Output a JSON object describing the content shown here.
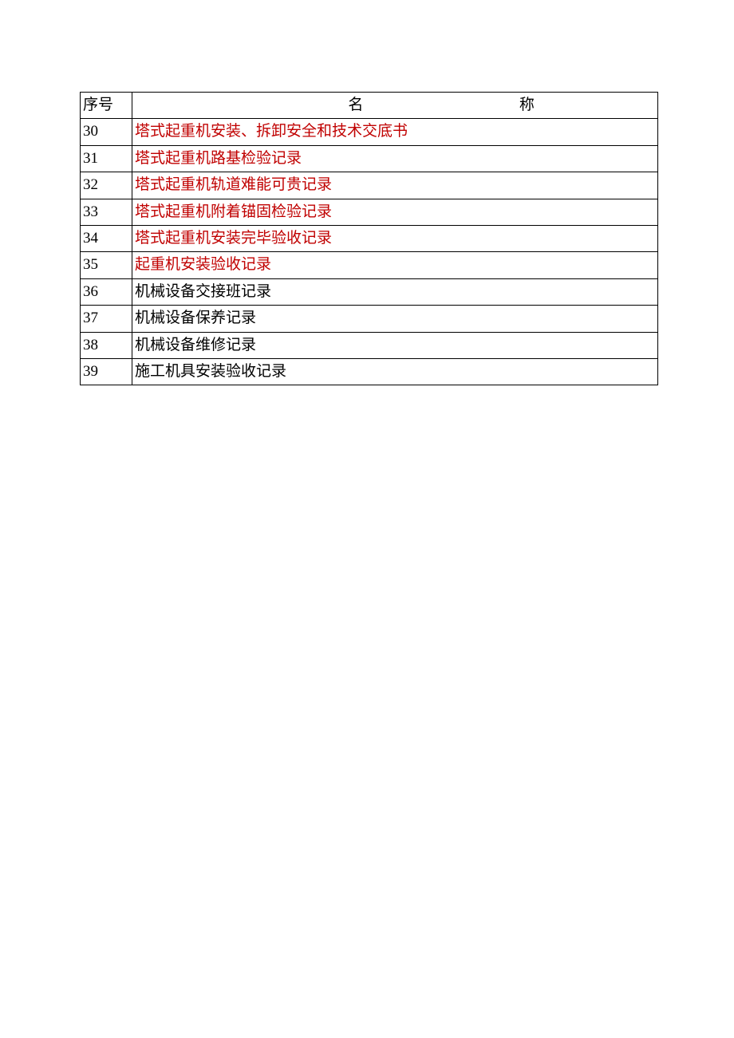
{
  "table": {
    "headers": {
      "seq": "序号",
      "name_char1": "名",
      "name_char2": "称"
    },
    "rows": [
      {
        "seq": "30",
        "name": "塔式起重机安装、拆卸安全和技术交底书",
        "highlight": true
      },
      {
        "seq": "31",
        "name": "塔式起重机路基检验记录",
        "highlight": true
      },
      {
        "seq": "32",
        "name": "塔式起重机轨道难能可贵记录",
        "highlight": true
      },
      {
        "seq": "33",
        "name": "塔式起重机附着锚固检验记录",
        "highlight": true
      },
      {
        "seq": "34",
        "name": "塔式起重机安装完毕验收记录",
        "highlight": true
      },
      {
        "seq": "35",
        "name": "起重机安装验收记录",
        "highlight": true
      },
      {
        "seq": "36",
        "name": "机械设备交接班记录",
        "highlight": false
      },
      {
        "seq": "37",
        "name": "机械设备保养记录",
        "highlight": false
      },
      {
        "seq": "38",
        "name": "机械设备维修记录",
        "highlight": false
      },
      {
        "seq": "39",
        "name": "施工机具安装验收记录",
        "highlight": false
      }
    ]
  },
  "colors": {
    "highlight": "#c00000",
    "text": "#000000",
    "border": "#000000"
  }
}
